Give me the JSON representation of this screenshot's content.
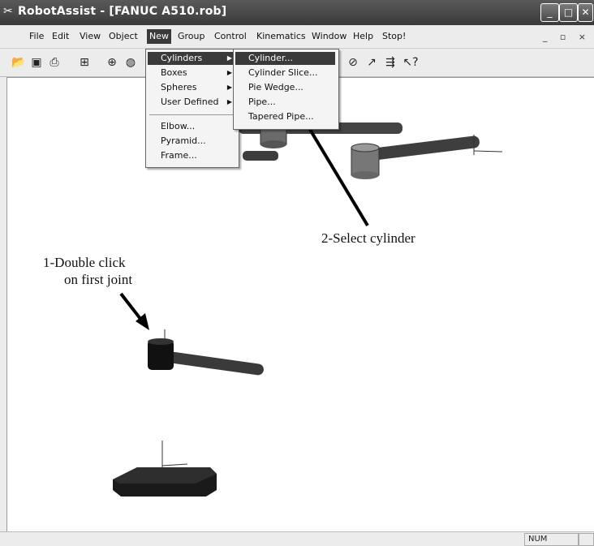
{
  "window": {
    "title": "RobotAssist - [FANUC A510.rob]",
    "app_icon": "robot-arm-icon",
    "controls": [
      "minimize-icon",
      "maximize-icon",
      "close-icon"
    ]
  },
  "menubar": {
    "items": [
      "File",
      "Edit",
      "View",
      "Object",
      "New",
      "Group",
      "Control",
      "Kinematics",
      "Window",
      "Help",
      "Stop!"
    ],
    "active_item": "New"
  },
  "toolbar": {
    "icons": [
      "open-folder-icon",
      "save-icon",
      "print-icon",
      "select-icon",
      "grid-icon",
      "cylinder-icon",
      "sphere-icon",
      "move-arrow-icon",
      "step-icon",
      "whats-this-icon"
    ]
  },
  "new_menu": {
    "items": [
      {
        "label": "Cylinders",
        "has_submenu": true,
        "selected": true
      },
      {
        "label": "Boxes",
        "has_submenu": true
      },
      {
        "label": "Spheres",
        "has_submenu": true
      },
      {
        "label": "User Defined",
        "has_submenu": true
      },
      {
        "label": "Elbow..."
      },
      {
        "label": "Pyramid..."
      },
      {
        "label": "Frame..."
      }
    ]
  },
  "cylinders_submenu": {
    "items": [
      {
        "label": "Cylinder...",
        "selected": true
      },
      {
        "label": "Cylinder Slice..."
      },
      {
        "label": "Pie Wedge..."
      },
      {
        "label": "Pipe..."
      },
      {
        "label": "Tapered Pipe..."
      }
    ]
  },
  "annotations": {
    "select_cylinder": "2-Select cylinder",
    "double_click_line1": "1-Double click",
    "double_click_line2": "on first joint"
  },
  "statusbar": {
    "num": "NUM"
  },
  "colors": {
    "titlebar": "#3a3a3a",
    "menu_highlight": "#3a3a3a",
    "robot_link": "#555555",
    "robot_base": "#222222"
  }
}
